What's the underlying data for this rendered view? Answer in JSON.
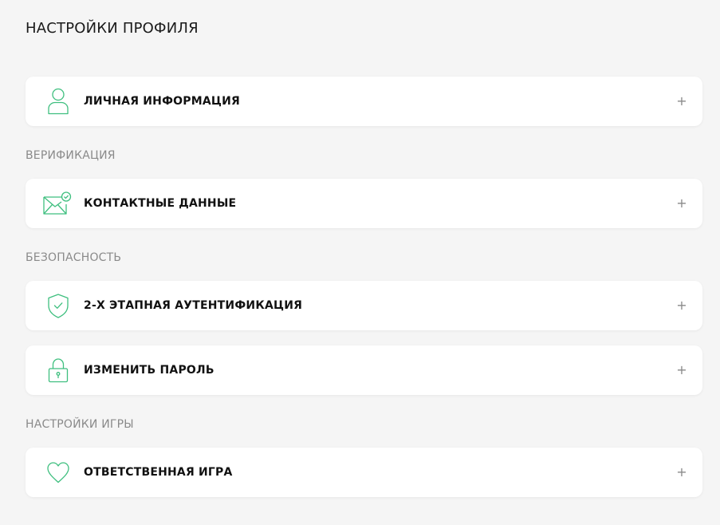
{
  "page": {
    "title": "НАСТРОЙКИ ПРОФИЛЯ"
  },
  "colors": {
    "accent": "#3fbf7f",
    "background": "#f5f5f5",
    "card": "#ffffff",
    "section_label": "#8a8a8a",
    "text": "#111111"
  },
  "sections": {
    "verification": {
      "label": "ВЕРИФИКАЦИЯ"
    },
    "security": {
      "label": "БЕЗОПАСНОСТЬ"
    },
    "game_settings": {
      "label": "НАСТРОЙКИ ИГРЫ"
    }
  },
  "cards": {
    "personal_info": {
      "label": "ЛИЧНАЯ ИНФОРМАЦИЯ",
      "icon": "user-icon",
      "expand": "+"
    },
    "contact_data": {
      "label": "КОНТАКТНЫЕ ДАННЫЕ",
      "icon": "envelope-check-icon",
      "expand": "+"
    },
    "two_factor": {
      "label": "2-Х ЭТАПНАЯ АУТЕНТИФИКАЦИЯ",
      "icon": "shield-check-icon",
      "expand": "+"
    },
    "change_password": {
      "label": "ИЗМЕНИТЬ ПАРОЛЬ",
      "icon": "lock-icon",
      "expand": "+"
    },
    "responsible_gaming": {
      "label": "ОТВЕТСТВЕННАЯ ИГРА",
      "icon": "heart-icon",
      "expand": "+"
    }
  }
}
